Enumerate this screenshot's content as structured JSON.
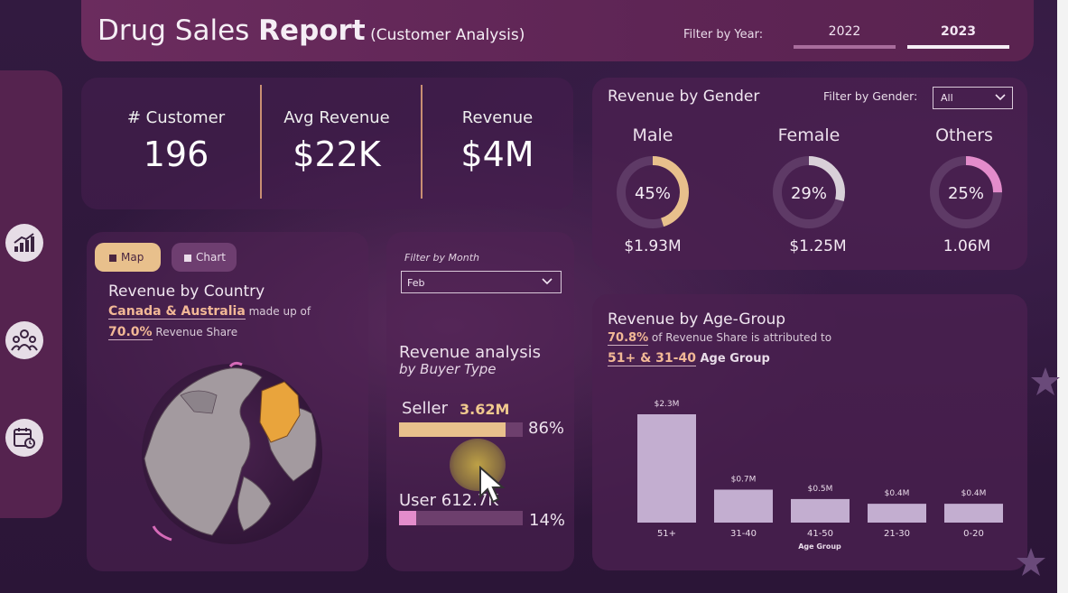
{
  "header": {
    "title_light": "Drug Sales ",
    "title_bold": "Report",
    "title_sub": " (Customer Analysis)",
    "filter_label": "Filter by Year:",
    "years": [
      "2022",
      "2023"
    ],
    "selected_year": "2023"
  },
  "sidebar": {
    "items": [
      {
        "icon": "growth-chart-icon"
      },
      {
        "icon": "customers-group-icon"
      },
      {
        "icon": "calendar-clock-icon"
      }
    ]
  },
  "kpis": [
    {
      "label": "# Customer",
      "value": "196"
    },
    {
      "label": "Avg Revenue",
      "value": "$22K"
    },
    {
      "label": "Revenue",
      "value": "$4M"
    }
  ],
  "gender": {
    "title": "Revenue by Gender",
    "filter_label": "Filter by Gender:",
    "filter_value": "All",
    "items": [
      {
        "name": "Male",
        "pct": 45,
        "pct_label": "45%",
        "revenue": "$1.93M",
        "color": "#e8c08c"
      },
      {
        "name": "Female",
        "pct": 29,
        "pct_label": "29%",
        "revenue": "$1.25M",
        "color": "#d8d0d8"
      },
      {
        "name": "Others",
        "pct": 25,
        "pct_label": "25%",
        "revenue": "1.06M",
        "color": "#e38ccb"
      }
    ]
  },
  "country": {
    "toggle_map": "Map",
    "toggle_chart": "Chart",
    "title": "Revenue by Country",
    "highlight": "Canada & Australia",
    "line1_rest": " made up of",
    "share": "70.0%",
    "line2_rest": " Revenue Share"
  },
  "buyer": {
    "filter_label": "Filter by Month",
    "month": "Feb",
    "title": "Revenue analysis",
    "subtitle": "by Buyer Type",
    "types": [
      {
        "name": "Seller",
        "value": "3.62M",
        "pct": 86,
        "pct_label": "86%",
        "color": "#e8c08c"
      },
      {
        "name": "User",
        "value": "612.7K",
        "pct": 14,
        "pct_label": "14%",
        "color": "#e38ccb"
      }
    ]
  },
  "age": {
    "title": "Revenue by Age-Group",
    "share": "70.8%",
    "line1_rest": " of Revenue Share is attributed to",
    "groups_hl": "51+ & 31-40",
    "line2_rest": " Age Group"
  },
  "chart_data": {
    "type": "bar",
    "categories": [
      "51+",
      "31-40",
      "41-50",
      "21-30",
      "0-20"
    ],
    "values": [
      2.3,
      0.7,
      0.5,
      0.4,
      0.4
    ],
    "data_labels": [
      "$2.3M",
      "$0.7M",
      "$0.5M",
      "$0.4M",
      "$0.4M"
    ],
    "xlabel": "Age Group",
    "ylabel": "",
    "ylim": [
      0,
      2.3
    ],
    "bar_color": "#c3aed0"
  }
}
